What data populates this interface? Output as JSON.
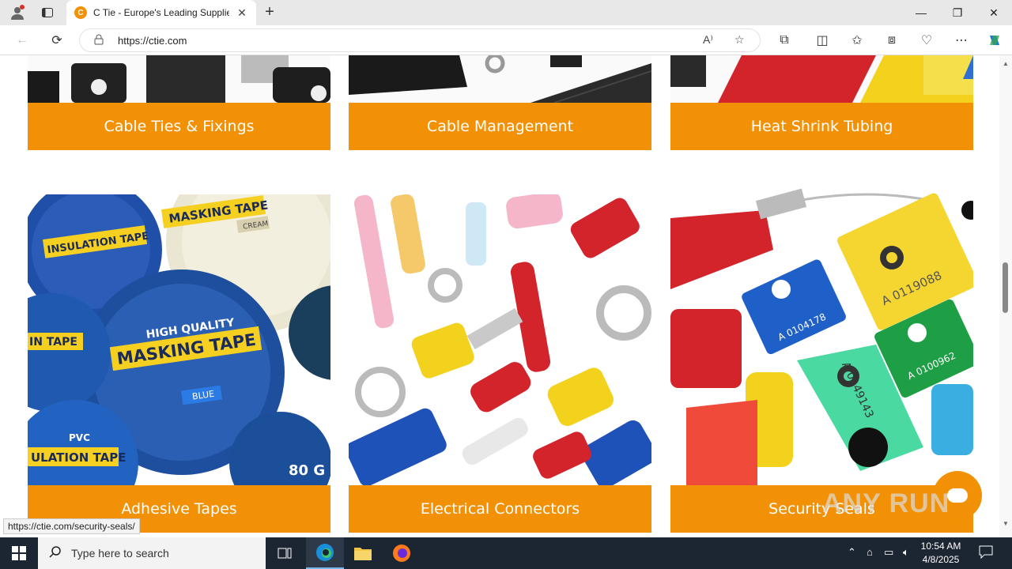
{
  "browser": {
    "tab_title": "C Tie - Europe's Leading Supplier",
    "url": "https://ctie.com",
    "status_url": "https://ctie.com/security-seals/"
  },
  "categories_top": [
    {
      "label": "Cable Ties & Fixings"
    },
    {
      "label": "Cable Management"
    },
    {
      "label": "Heat Shrink Tubing"
    }
  ],
  "categories_bottom": [
    {
      "label": "Adhesive Tapes"
    },
    {
      "label": "Electrical Connectors"
    },
    {
      "label": "Security Seals"
    }
  ],
  "product_text": {
    "tape1": "INSULATION TAPE",
    "tape2": "MASKING TAPE",
    "tape3": "HIGH QUALITY",
    "tape4": "MASKING TAPE",
    "tape5": "BLUE",
    "tape6": "CREAM",
    "tape7": "IN TAPE",
    "tape8": "ULATION TAPE",
    "tape9": "PVC",
    "tape10": "80 G",
    "seal1": "A 0104178",
    "seal2": "A 0119088",
    "seal3": "A 0100962",
    "seal4": "A 0149143"
  },
  "watermark": "ANY RUN",
  "taskbar": {
    "search_placeholder": "Type here to search",
    "time": "10:54 AM",
    "date": "4/8/2025"
  },
  "colors": {
    "accent": "#f29105"
  }
}
